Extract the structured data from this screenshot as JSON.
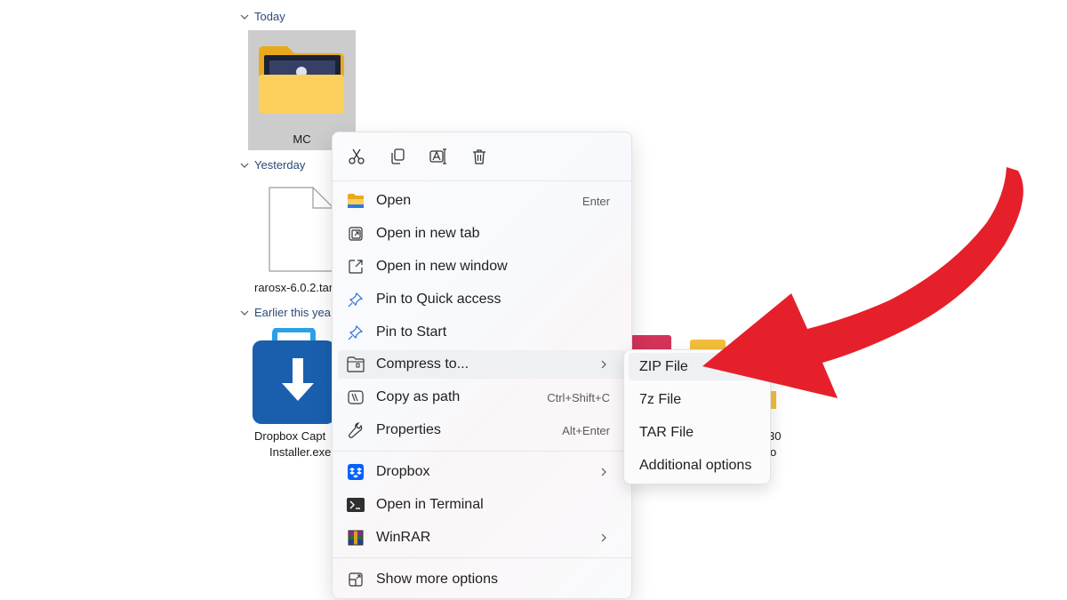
{
  "groups": {
    "today": "Today",
    "yesterday": "Yesterday",
    "earlier": "Earlier this yea"
  },
  "files": {
    "mc": "MC",
    "rarosx": "rarosx-6.0.2.tar",
    "dropbox_line1": "Dropbox Capt",
    "dropbox_line2": "Installer.exe",
    "partial_label": "30",
    "partial_label2": "o"
  },
  "context_menu": {
    "toolbar_icons": [
      "cut-icon",
      "copy-icon",
      "rename-icon",
      "delete-icon"
    ],
    "items": [
      {
        "label": "Open",
        "accel": "Enter",
        "icon": "folder-icon"
      },
      {
        "label": "Open in new tab",
        "accel": "",
        "icon": "new-tab-icon"
      },
      {
        "label": "Open in new window",
        "accel": "",
        "icon": "new-window-icon"
      },
      {
        "label": "Pin to Quick access",
        "accel": "",
        "icon": "pin-icon"
      },
      {
        "label": "Pin to Start",
        "accel": "",
        "icon": "pin-icon"
      },
      {
        "label": "Compress to...",
        "accel": "",
        "icon": "zip-folder-icon"
      },
      {
        "label": "Copy as path",
        "accel": "Ctrl+Shift+C",
        "icon": "path-icon"
      },
      {
        "label": "Properties",
        "accel": "Alt+Enter",
        "icon": "wrench-icon"
      },
      {
        "label": "Dropbox",
        "accel": "",
        "icon": "dropbox-icon"
      },
      {
        "label": "Open in Terminal",
        "accel": "",
        "icon": "terminal-icon"
      },
      {
        "label": "WinRAR",
        "accel": "",
        "icon": "winrar-icon"
      },
      {
        "label": "Show more options",
        "accel": "",
        "icon": "more-options-icon"
      }
    ]
  },
  "submenu": {
    "items": [
      "ZIP File",
      "7z File",
      "TAR File",
      "Additional options"
    ]
  },
  "colors": {
    "accent_red": "#e5202a",
    "folder_yellow": "#f5c242",
    "dropbox_blue": "#0061fe",
    "selected_bg": "#cccccc",
    "group_text": "#2b4a7a"
  }
}
